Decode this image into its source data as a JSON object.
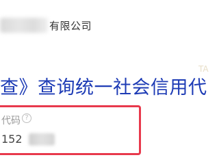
{
  "company": {
    "name_suffix": "有限公司"
  },
  "caption": {
    "text": "查》查询统一社会信用代"
  },
  "watermark": {
    "text": "TA"
  },
  "credit_code_field": {
    "label": "代码",
    "help_icon": "question-circle-icon",
    "value_prefix": "152"
  },
  "colors": {
    "caption_blue": "#1d3bb5",
    "highlight_red": "#e8394c",
    "label_gray": "#9a9a9a"
  }
}
